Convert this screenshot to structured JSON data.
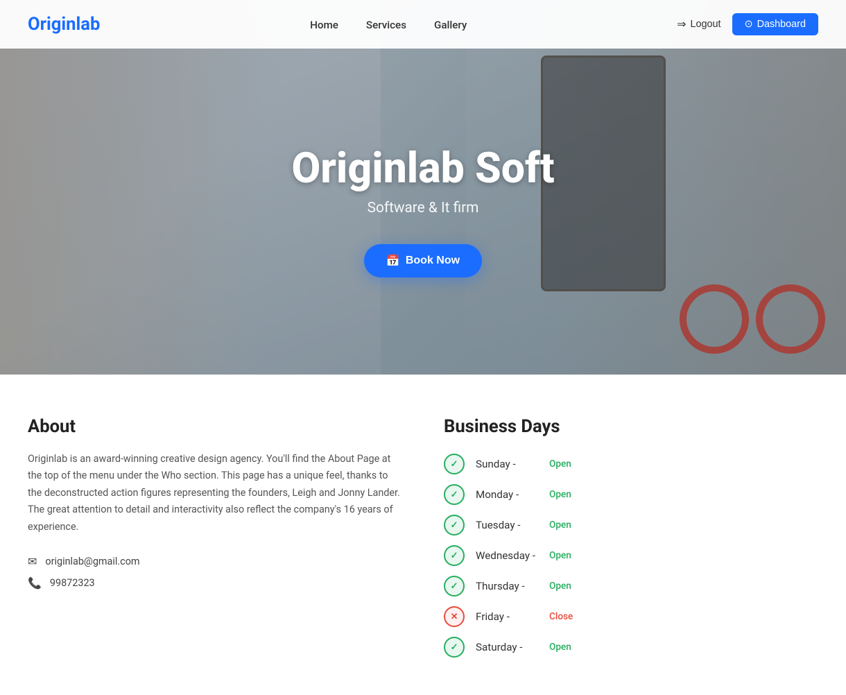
{
  "brand": {
    "logo": "Originlab"
  },
  "navbar": {
    "links": [
      {
        "label": "Home",
        "href": "#"
      },
      {
        "label": "Services",
        "href": "#"
      },
      {
        "label": "Gallery",
        "href": "#"
      }
    ],
    "logout_label": "Logout",
    "dashboard_label": "Dashboard"
  },
  "hero": {
    "title": "Originlab Soft",
    "subtitle": "Software & It firm",
    "book_button": "Book Now",
    "carousel_dot": "•"
  },
  "about": {
    "title": "About",
    "text": "Originlab is an award-winning creative design agency. You'll find the About Page at the top of the menu under the Who section. This page has a unique feel, thanks to the deconstructed action figures representing the founders, Leigh and Jonny Lander. The great attention to detail and interactivity also reflect the company's 16 years of experience.",
    "email": "originlab@gmail.com",
    "phone": "99872323"
  },
  "business": {
    "title": "Business Days",
    "days": [
      {
        "name": "Sunday",
        "status": "Open",
        "open": true
      },
      {
        "name": "Monday",
        "status": "Open",
        "open": true
      },
      {
        "name": "Tuesday",
        "status": "Open",
        "open": true
      },
      {
        "name": "Wednesday",
        "status": "Open",
        "open": true
      },
      {
        "name": "Thursday",
        "status": "Open",
        "open": true
      },
      {
        "name": "Friday",
        "status": "Close",
        "open": false
      },
      {
        "name": "Saturday",
        "status": "Open",
        "open": true
      }
    ]
  },
  "icons": {
    "logout": "→",
    "dashboard": "⊙",
    "calendar": "📅",
    "email": "✉",
    "phone": "📞",
    "check": "✓",
    "cross": "✕"
  }
}
